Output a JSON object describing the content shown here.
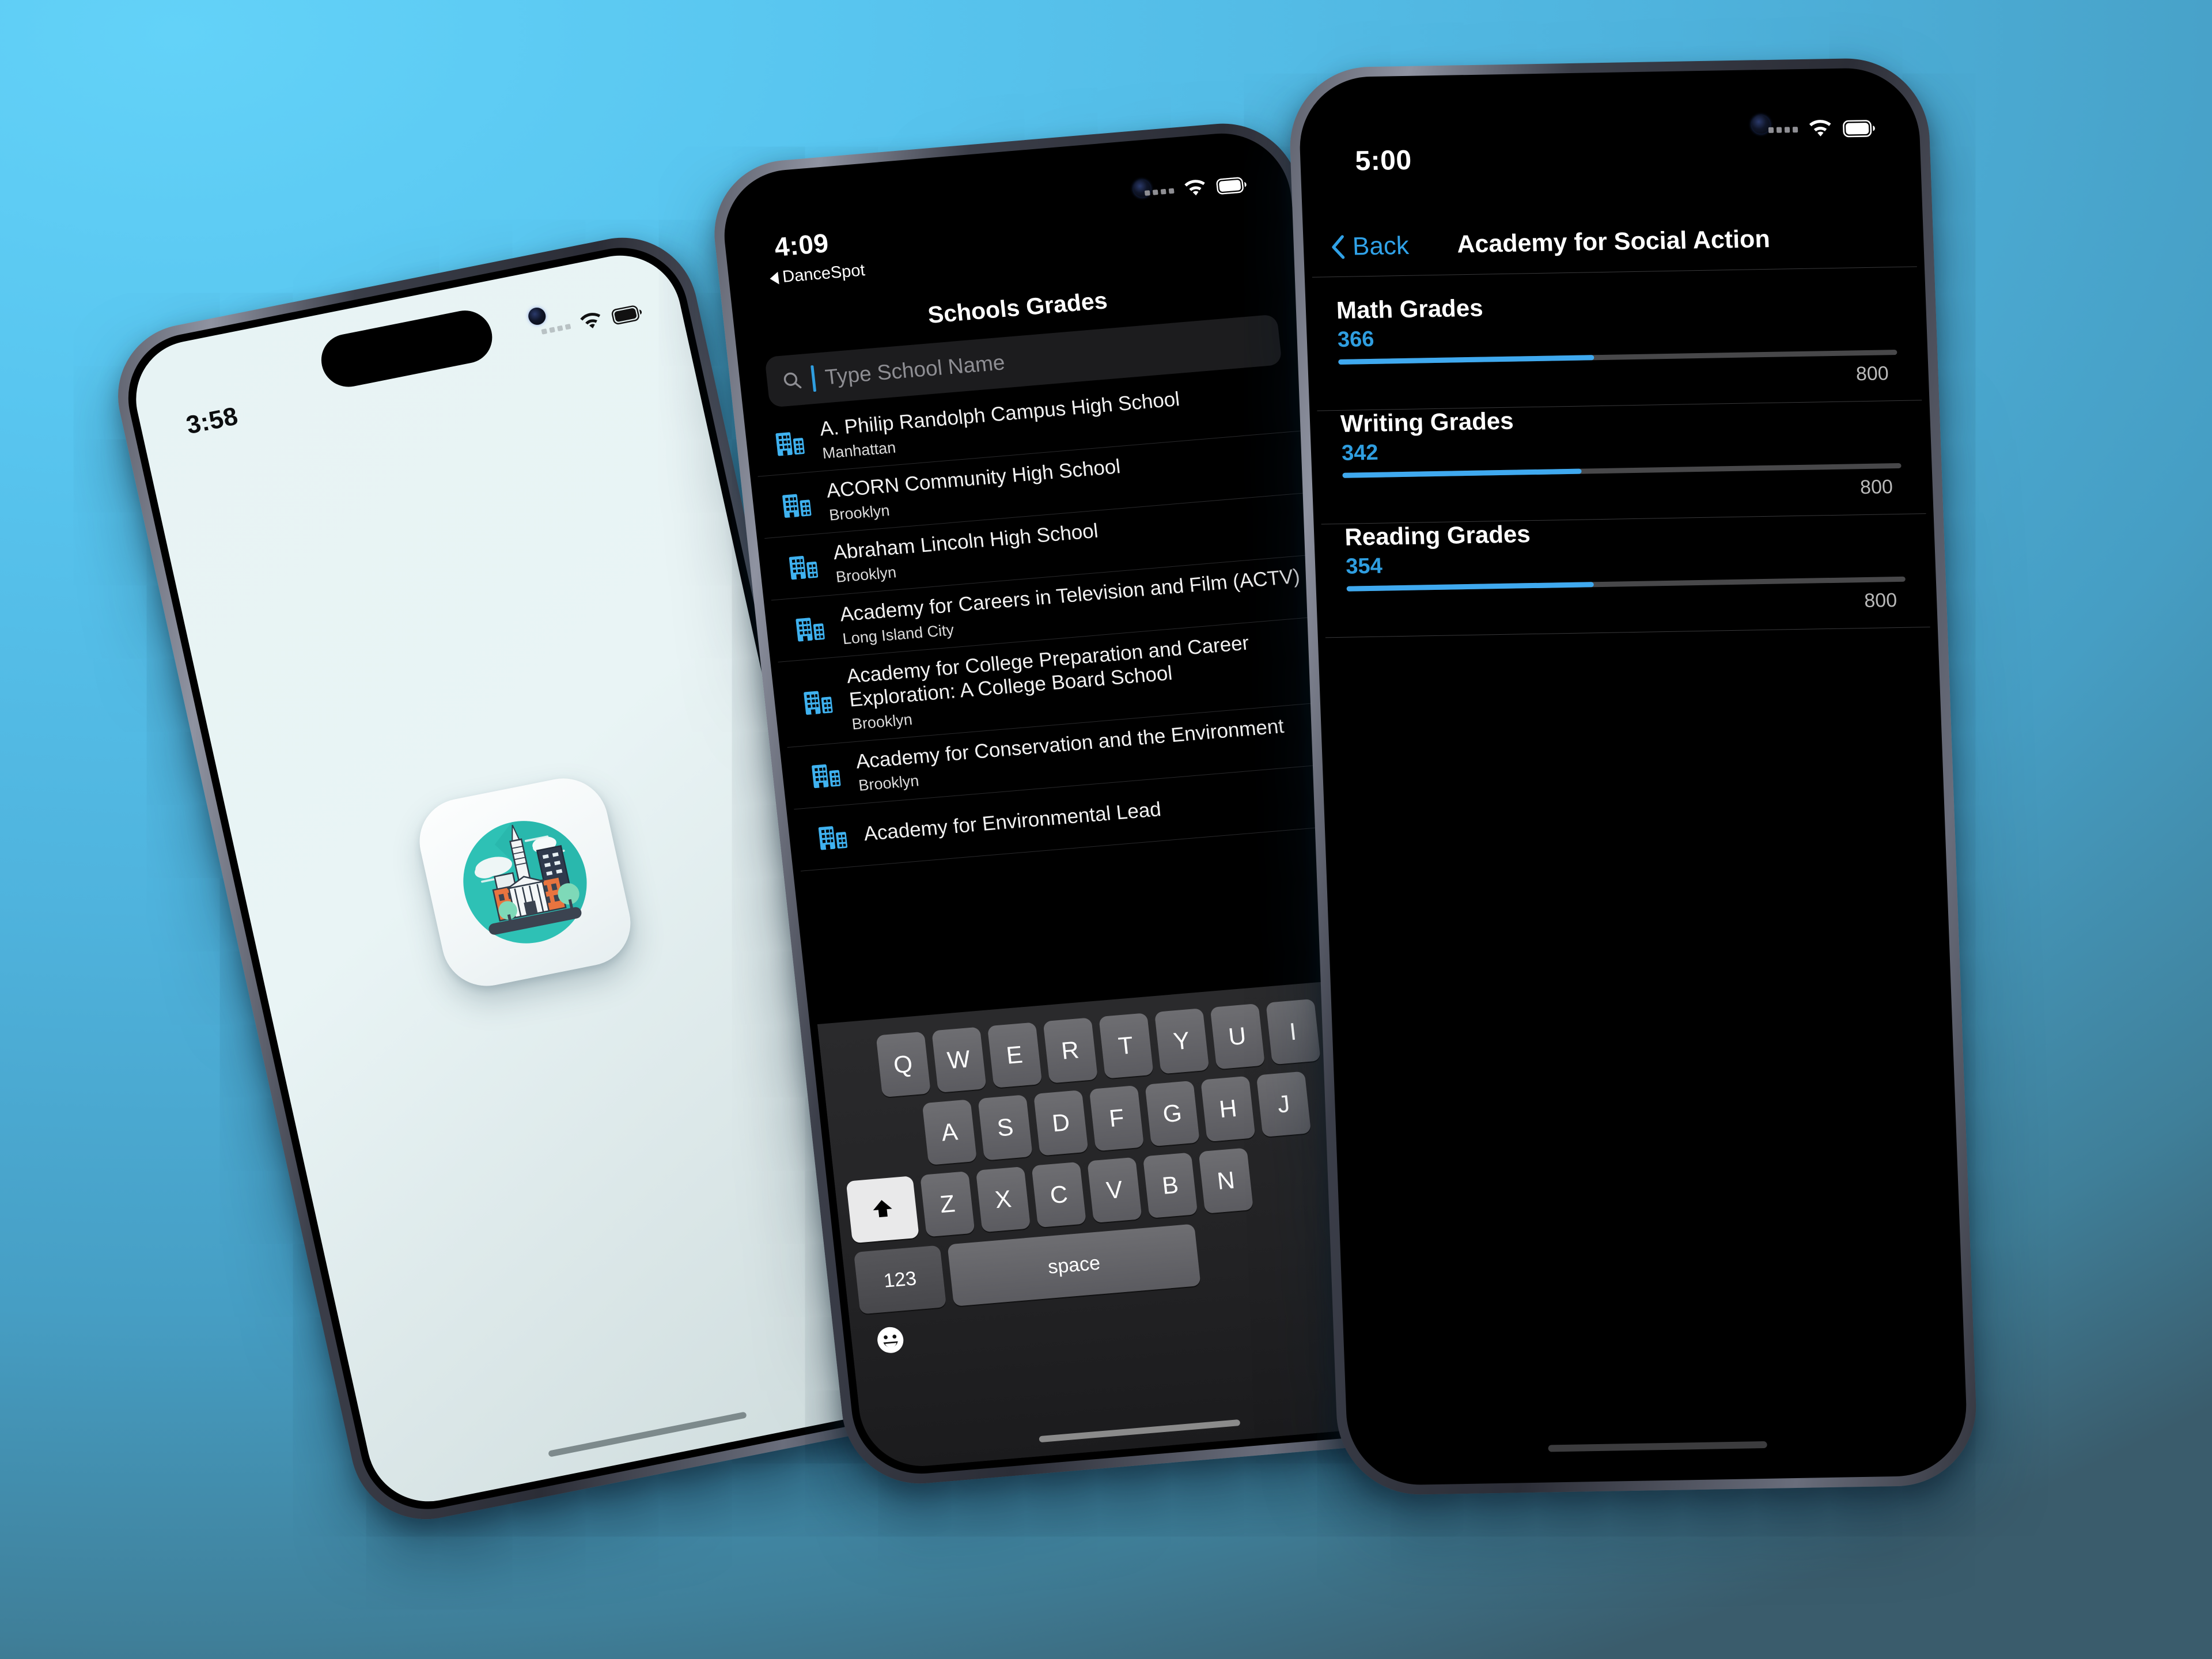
{
  "background": {
    "top_color": "#5cc9f3",
    "bottom_color": "#3a5c6c"
  },
  "accent_color": "#2f9ee0",
  "phone_left": {
    "status": {
      "time": "3:58",
      "wifi_icon": "wifi-icon",
      "battery_icon": "battery-icon",
      "cellular_icon": "cellular-bars-icon"
    },
    "app_icon": {
      "name": "city-skyline-app-icon",
      "alt": "City skyline with school building"
    },
    "home_indicator": "home-indicator"
  },
  "phone_middle": {
    "status": {
      "time": "4:09",
      "back_app_label": "DanceSpot",
      "wifi_icon": "wifi-icon",
      "battery_icon": "battery-icon",
      "cellular_icon": "cellular-bars-icon"
    },
    "nav_title": "Schools Grades",
    "search": {
      "placeholder": "Type School Name",
      "value": "",
      "icon": "search-icon"
    },
    "schools": [
      {
        "name": "A. Philip Randolph Campus High School",
        "borough": "Manhattan"
      },
      {
        "name": "ACORN Community High School",
        "borough": "Brooklyn"
      },
      {
        "name": "Abraham Lincoln High School",
        "borough": "Brooklyn"
      },
      {
        "name": "Academy for Careers in Television and Film (ACTV)",
        "borough": "Long Island City"
      },
      {
        "name": "Academy for College Preparation and Career Exploration: A College Board School",
        "borough": "Brooklyn"
      },
      {
        "name": "Academy for Conservation and the Environment",
        "borough": "Brooklyn"
      },
      {
        "name": "Academy for Environmental Lead",
        "borough": ""
      }
    ],
    "keyboard": {
      "row1": [
        "Q",
        "W",
        "E",
        "R",
        "T",
        "Y",
        "U",
        "I"
      ],
      "row2": [
        "A",
        "S",
        "D",
        "F",
        "G",
        "H",
        "J"
      ],
      "row3": [
        "Z",
        "X",
        "C",
        "V",
        "B",
        "N"
      ],
      "shift_key": "shift-key",
      "numbers_key": "123",
      "space_key": "space",
      "emoji_key": "emoji-icon"
    },
    "home_indicator": "home-indicator"
  },
  "phone_right": {
    "status": {
      "time": "5:00",
      "wifi_icon": "wifi-icon",
      "battery_icon": "battery-icon",
      "cellular_icon": "cellular-bars-icon"
    },
    "back_label": "Back",
    "title": "Academy for Social Action",
    "grades": [
      {
        "label": "Math Grades",
        "value": "366",
        "max": "800",
        "percent": 45.75
      },
      {
        "label": "Writing Grades",
        "value": "342",
        "max": "800",
        "percent": 42.75
      },
      {
        "label": "Reading Grades",
        "value": "354",
        "max": "800",
        "percent": 44.25
      }
    ],
    "home_indicator": "home-indicator"
  }
}
